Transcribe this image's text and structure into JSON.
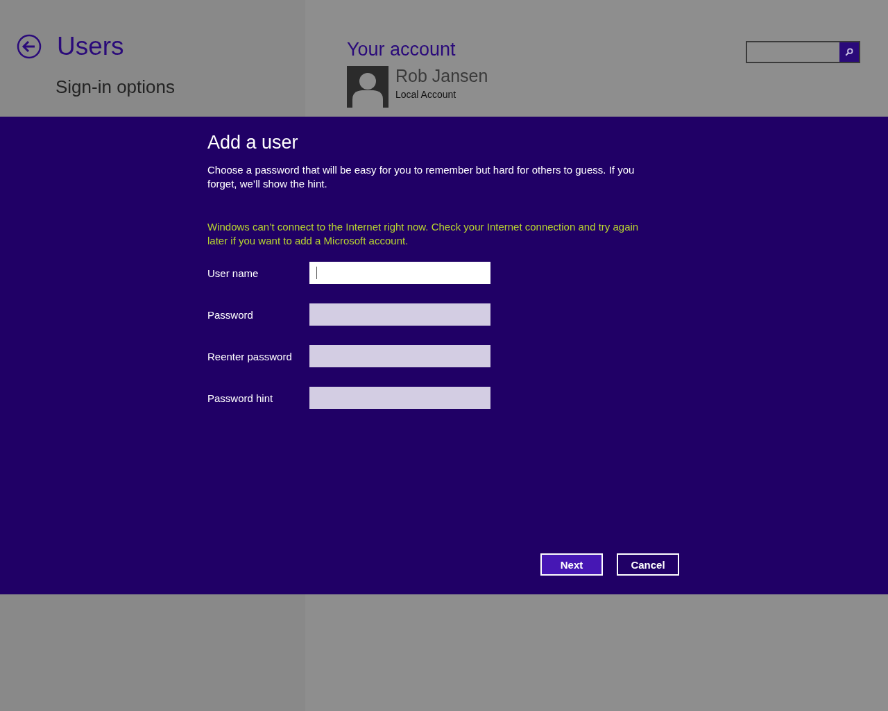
{
  "page": {
    "title": "Users",
    "subtitle": "Sign-in options",
    "section_title": "Your account",
    "account": {
      "name": "Rob Jansen",
      "type": "Local Account"
    }
  },
  "dialog": {
    "title": "Add a user",
    "description": "Choose a password that will be easy for you to remember but hard for others to guess. If you forget, we’ll show the hint.",
    "warning": "Windows can’t connect to the Internet right now. Check your Internet connection and try again later if you want to add a Microsoft account.",
    "fields": [
      {
        "label": "User name",
        "focused": true
      },
      {
        "label": "Password",
        "focused": false
      },
      {
        "label": "Reenter password",
        "focused": false
      },
      {
        "label": "Password hint",
        "focused": false
      }
    ],
    "buttons": [
      {
        "label": "Next",
        "kind": "primary"
      },
      {
        "label": "Cancel",
        "kind": "secondary"
      }
    ]
  }
}
